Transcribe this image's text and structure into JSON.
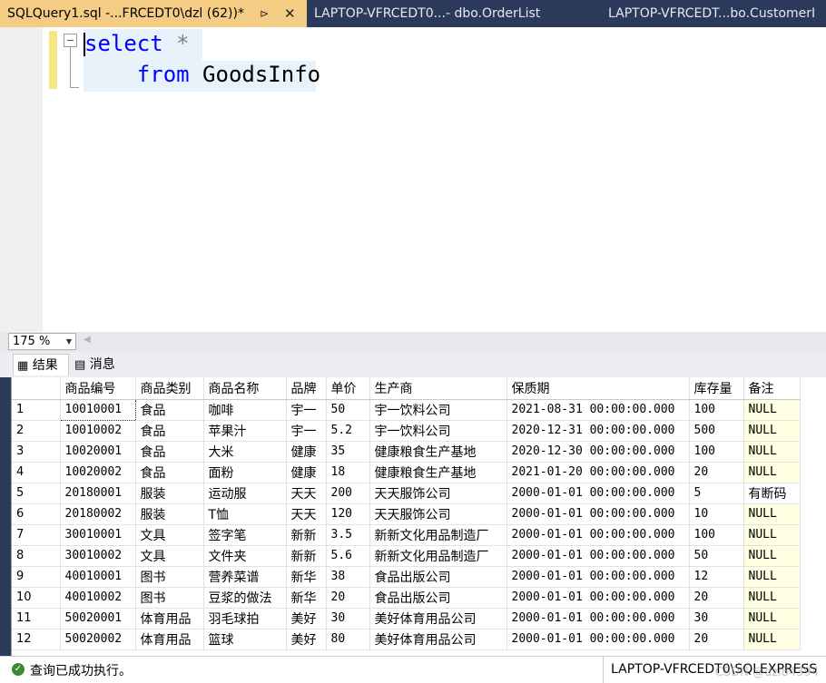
{
  "tabs": [
    {
      "label": "SQLQuery1.sql -...FRCEDT0\\dzl (62))*",
      "active": true
    },
    {
      "label": "LAPTOP-VFRCEDT0...- dbo.OrderList",
      "active": false
    },
    {
      "label": "LAPTOP-VFRCEDT...bo.CustomerI",
      "active": false
    }
  ],
  "editor": {
    "line1_kw": "select",
    "line1_op": " *",
    "line2_kw": "from",
    "line2_ident": " GoodsInfo"
  },
  "zoom": {
    "value": "175 %"
  },
  "result_tabs": {
    "results": "结果",
    "messages": "消息"
  },
  "grid": {
    "columns": [
      "商品编号",
      "商品类别",
      "商品名称",
      "品牌",
      "单价",
      "生产商",
      "保质期",
      "库存量",
      "备注"
    ],
    "rows": [
      [
        "1",
        "10010001",
        "食品",
        "咖啡",
        "宇一",
        "50",
        "宇一饮料公司",
        "2021-08-31 00:00:00.000",
        "100",
        "NULL"
      ],
      [
        "2",
        "10010002",
        "食品",
        "苹果汁",
        "宇一",
        "5.2",
        "宇一饮料公司",
        "2020-12-31 00:00:00.000",
        "500",
        "NULL"
      ],
      [
        "3",
        "10020001",
        "食品",
        "大米",
        "健康",
        "35",
        "健康粮食生产基地",
        "2020-12-30 00:00:00.000",
        "100",
        "NULL"
      ],
      [
        "4",
        "10020002",
        "食品",
        "面粉",
        "健康",
        "18",
        "健康粮食生产基地",
        "2021-01-20 00:00:00.000",
        "20",
        "NULL"
      ],
      [
        "5",
        "20180001",
        "服装",
        "运动服",
        "天天",
        "200",
        "天天服饰公司",
        "2000-01-01 00:00:00.000",
        "5",
        "有断码"
      ],
      [
        "6",
        "20180002",
        "服装",
        "T恤",
        "天天",
        "120",
        "天天服饰公司",
        "2000-01-01 00:00:00.000",
        "10",
        "NULL"
      ],
      [
        "7",
        "30010001",
        "文具",
        "签字笔",
        "新新",
        "3.5",
        "新新文化用品制造厂",
        "2000-01-01 00:00:00.000",
        "100",
        "NULL"
      ],
      [
        "8",
        "30010002",
        "文具",
        "文件夹",
        "新新",
        "5.6",
        "新新文化用品制造厂",
        "2000-01-01 00:00:00.000",
        "50",
        "NULL"
      ],
      [
        "9",
        "40010001",
        "图书",
        "营养菜谱",
        "新华",
        "38",
        "食品出版公司",
        "2000-01-01 00:00:00.000",
        "12",
        "NULL"
      ],
      [
        "10",
        "40010002",
        "图书",
        "豆浆的做法",
        "新华",
        "20",
        "食品出版公司",
        "2000-01-01 00:00:00.000",
        "20",
        "NULL"
      ],
      [
        "11",
        "50020001",
        "体育用品",
        "羽毛球拍",
        "美好",
        "30",
        "美好体育用品公司",
        "2000-01-01 00:00:00.000",
        "30",
        "NULL"
      ],
      [
        "12",
        "50020002",
        "体育用品",
        "篮球",
        "美好",
        "80",
        "美好体育用品公司",
        "2000-01-01 00:00:00.000",
        "20",
        "NULL"
      ]
    ]
  },
  "status": {
    "message": "查询已成功执行。",
    "server": "LAPTOP-VFRCEDT0\\SQLEXPRESS",
    "watermark": "CSDN @dzl84394"
  },
  "colors": {
    "active_tab": "#f5cc84",
    "tab_bar": "#2b3a5a",
    "keyword": "#0000ff",
    "null_cell": "#ffffe1"
  }
}
